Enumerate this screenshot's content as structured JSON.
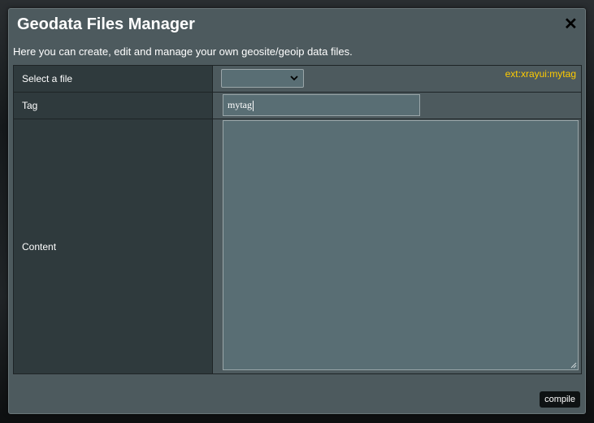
{
  "dialog": {
    "title": "Geodata Files Manager",
    "close_label": "✕",
    "description": "Here you can create, edit and manage your own geosite/geoip data files."
  },
  "form": {
    "file_row": {
      "label": "Select a file",
      "selected_value": "",
      "tag_hint": "ext:xrayui:mytag"
    },
    "tag_row": {
      "label": "Tag",
      "value": "mytag"
    },
    "content_row": {
      "label": "Content",
      "value": ""
    }
  },
  "footer": {
    "compile_label": "compile"
  },
  "icons": {
    "close": "close-icon",
    "dropdown": "chevron-down-icon",
    "resize": "resize-grip-icon"
  },
  "colors": {
    "hint": "#ffcc00",
    "modal_bg": "#4d5a5e",
    "label_bg": "#2f3a3d",
    "input_bg": "#596e74"
  }
}
